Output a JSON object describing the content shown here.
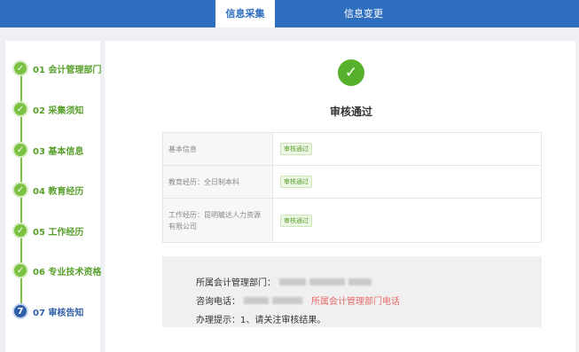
{
  "topbar": {
    "tabs": [
      {
        "label": "信息采集",
        "active": true
      },
      {
        "label": "信息变更",
        "active": false
      }
    ]
  },
  "steps": [
    {
      "marker": "✓",
      "label": "01 会计管理部门",
      "status": "done"
    },
    {
      "marker": "✓",
      "label": "02 采集须知",
      "status": "done"
    },
    {
      "marker": "✓",
      "label": "03 基本信息",
      "status": "done"
    },
    {
      "marker": "✓",
      "label": "04 教育经历",
      "status": "done"
    },
    {
      "marker": "✓",
      "label": "05 工作经历",
      "status": "done"
    },
    {
      "marker": "✓",
      "label": "06 专业技术资格",
      "status": "done"
    },
    {
      "marker": "7",
      "label": "07 审核告知",
      "status": "current"
    }
  ],
  "result": {
    "icon": "check-circle-icon",
    "title": "审核通过"
  },
  "review_table": [
    {
      "label": "基本信息",
      "status": "审核通过"
    },
    {
      "label": "教育经历：全日制本科",
      "status": "审核通过"
    },
    {
      "label": "工作经历：昆明毓达人力资源有限公司",
      "status": "审核通过"
    }
  ],
  "info": {
    "dept_label": "所属会计管理部门：",
    "phone_label": "咨询电话：",
    "phone_note": "所属会计管理部门电话",
    "tip": "办理提示：1、请关注审核结果。"
  },
  "colors": {
    "primary": "#2f6fbf",
    "success": "#58b12c",
    "accent_red": "#e86a6a"
  }
}
